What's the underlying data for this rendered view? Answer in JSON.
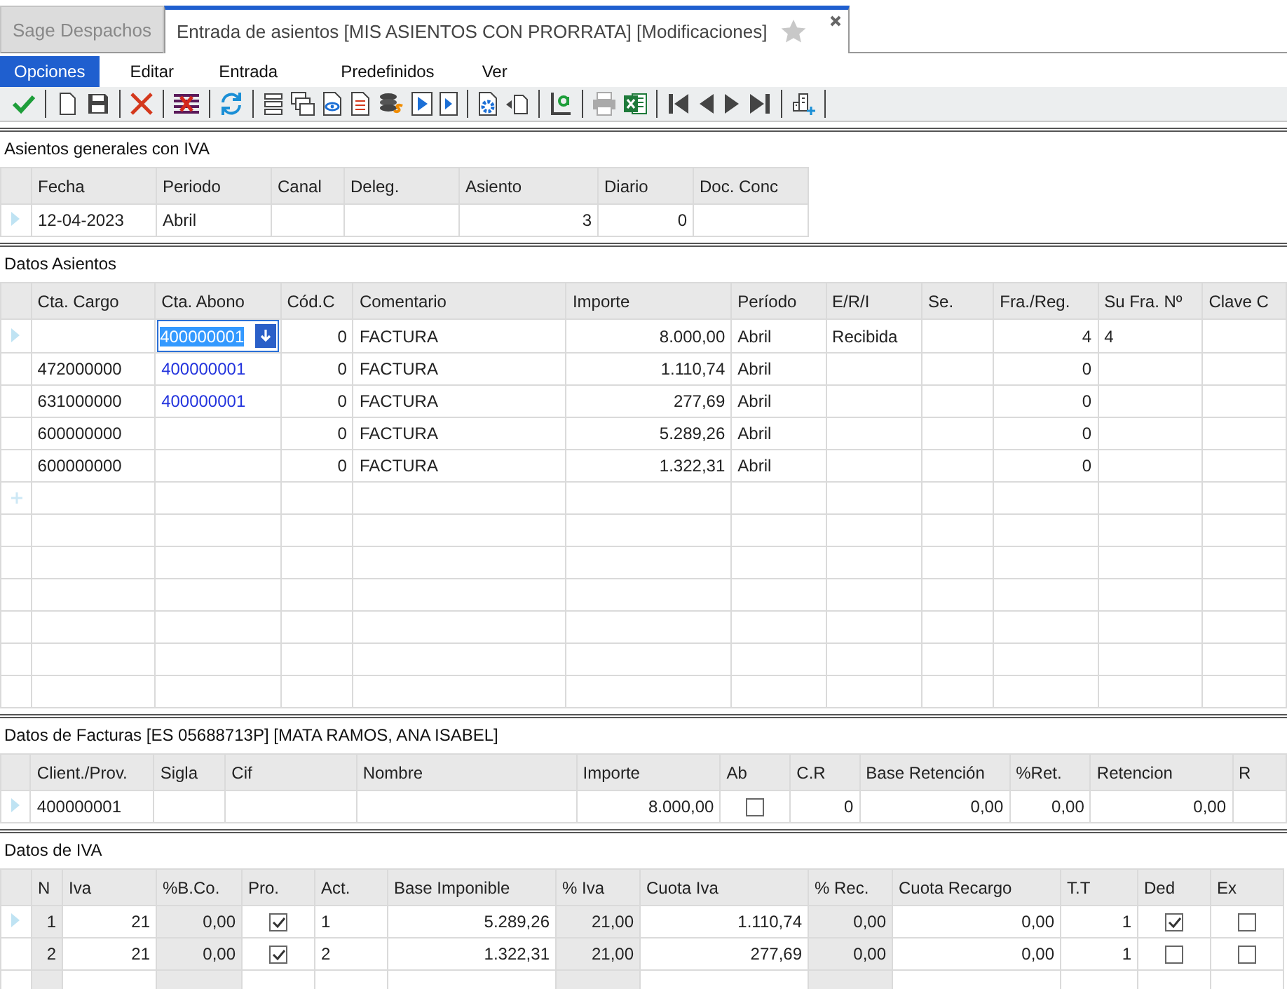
{
  "tabs": [
    {
      "label": "Sage Despachos",
      "selected": false,
      "closable": false
    },
    {
      "label": "Entrada de asientos [MIS ASIENTOS CON PRORRATA] [Modificaciones]",
      "selected": true,
      "closable": true,
      "favorite": false
    }
  ],
  "menu": [
    {
      "label": "Opciones",
      "selected": true
    },
    {
      "label": "Editar",
      "selected": false
    },
    {
      "label": "Entrada",
      "selected": false
    },
    {
      "label": "Predefinidos",
      "selected": false
    },
    {
      "label": "Ver",
      "selected": false
    }
  ],
  "toolbar": [
    {
      "kind": "accept"
    },
    {
      "kind": "separator"
    },
    {
      "kind": "new"
    },
    {
      "kind": "save"
    },
    {
      "kind": "separator"
    },
    {
      "kind": "delete"
    },
    {
      "kind": "separator"
    },
    {
      "kind": "void"
    },
    {
      "kind": "separator"
    },
    {
      "kind": "refresh"
    },
    {
      "kind": "separator"
    },
    {
      "kind": "list"
    },
    {
      "kind": "windows"
    },
    {
      "kind": "view"
    },
    {
      "kind": "document"
    },
    {
      "kind": "coins"
    },
    {
      "kind": "play"
    },
    {
      "kind": "play-small"
    },
    {
      "kind": "separator"
    },
    {
      "kind": "settings-doc"
    },
    {
      "kind": "back-doc"
    },
    {
      "kind": "separator"
    },
    {
      "kind": "text-a"
    },
    {
      "kind": "separator"
    },
    {
      "kind": "print",
      "disabled": true
    },
    {
      "kind": "excel"
    },
    {
      "kind": "separator"
    },
    {
      "kind": "first"
    },
    {
      "kind": "prev"
    },
    {
      "kind": "next"
    },
    {
      "kind": "last"
    },
    {
      "kind": "separator"
    },
    {
      "kind": "building-add"
    },
    {
      "kind": "separator"
    }
  ],
  "sections": [
    {
      "title": "Asientos generales con IVA",
      "columns": [
        {
          "label": "Fecha"
        },
        {
          "label": "Periodo"
        },
        {
          "label": "Canal"
        },
        {
          "label": "Deleg."
        },
        {
          "label": "Asiento",
          "numeric": true
        },
        {
          "label": "Diario",
          "numeric": true
        },
        {
          "label": "Doc. Conc"
        }
      ],
      "rows": [
        {
          "current": true,
          "cells": [
            "12-04-2023",
            "Abril",
            "",
            "",
            "3",
            "0",
            ""
          ]
        }
      ]
    },
    {
      "title": "Datos Asientos",
      "new_row": true,
      "columns": [
        {
          "label": "Cta. Cargo"
        },
        {
          "label": "Cta. Abono",
          "link": true
        },
        {
          "label": "Cód.C",
          "numeric": true
        },
        {
          "label": "Comentario"
        },
        {
          "label": "Importe",
          "numeric": true
        },
        {
          "label": "Período"
        },
        {
          "label": "E/R/I"
        },
        {
          "label": "Se."
        },
        {
          "label": "Fra./Reg.",
          "numeric": true
        },
        {
          "label": "Su Fra. Nº"
        },
        {
          "label": "Clave C"
        }
      ],
      "rows": [
        {
          "current": true,
          "cells": [
            "",
            {
              "text": "400000001",
              "editing": true
            },
            "0",
            "FACTURA",
            "8.000,00",
            "Abril",
            "Recibida",
            "",
            "4",
            "4",
            ""
          ]
        },
        {
          "current": false,
          "cells": [
            "472000000",
            "400000001",
            "0",
            "FACTURA",
            "1.110,74",
            "Abril",
            "",
            "",
            "0",
            "",
            ""
          ]
        },
        {
          "current": false,
          "cells": [
            "631000000",
            "400000001",
            "0",
            "FACTURA",
            "277,69",
            "Abril",
            "",
            "",
            "0",
            "",
            ""
          ]
        },
        {
          "current": false,
          "cells": [
            "600000000",
            "",
            "0",
            "FACTURA",
            "5.289,26",
            "Abril",
            "",
            "",
            "0",
            "",
            ""
          ]
        },
        {
          "current": false,
          "cells": [
            "600000000",
            "",
            "0",
            "FACTURA",
            "1.322,31",
            "Abril",
            "",
            "",
            "0",
            "",
            ""
          ]
        }
      ]
    },
    {
      "title": "Datos de Facturas [ES 05688713P] [MATA RAMOS, ANA ISABEL]",
      "columns": [
        {
          "label": "Client./Prov."
        },
        {
          "label": "Sigla"
        },
        {
          "label": "Cif"
        },
        {
          "label": "Nombre"
        },
        {
          "label": "Importe",
          "numeric": true
        },
        {
          "label": "Ab"
        },
        {
          "label": "C.R",
          "numeric": true
        },
        {
          "label": "Base Retención",
          "numeric": true
        },
        {
          "label": "%Ret.",
          "numeric": true
        },
        {
          "label": "Retencion",
          "numeric": true
        },
        {
          "label": "R"
        }
      ],
      "rows": [
        {
          "current": true,
          "cells": [
            "400000001",
            "",
            "",
            "",
            "8.000,00",
            {
              "checked": false
            },
            "0",
            "0,00",
            "0,00",
            "0,00",
            ""
          ]
        }
      ]
    },
    {
      "title": "Datos de IVA",
      "columns": [
        {
          "label": "N",
          "numeric": true,
          "shaded": true
        },
        {
          "label": "Iva",
          "numeric": true
        },
        {
          "label": "%B.Co.",
          "numeric": true,
          "shaded": true
        },
        {
          "label": "Pro."
        },
        {
          "label": "Act."
        },
        {
          "label": "Base Imponible",
          "numeric": true
        },
        {
          "label": "% Iva",
          "numeric": true,
          "shaded": true
        },
        {
          "label": "Cuota Iva",
          "numeric": true
        },
        {
          "label": "% Rec.",
          "numeric": true,
          "shaded": true
        },
        {
          "label": "Cuota Recargo",
          "numeric": true
        },
        {
          "label": "T.T",
          "numeric": true
        },
        {
          "label": "Ded"
        },
        {
          "label": "Ex"
        }
      ],
      "rows": [
        {
          "current": true,
          "cells": [
            "1",
            "21",
            "0,00",
            {
              "checked": true
            },
            "1",
            "5.289,26",
            "21,00",
            "1.110,74",
            "0,00",
            "0,00",
            "1",
            {
              "checked": true
            },
            {
              "checked": false
            }
          ]
        },
        {
          "current": false,
          "cells": [
            "2",
            "21",
            "0,00",
            {
              "checked": true
            },
            "2",
            "1.322,31",
            "21,00",
            "277,69",
            "0,00",
            "0,00",
            "1",
            {
              "checked": false
            },
            {
              "checked": false
            }
          ]
        }
      ]
    }
  ]
}
